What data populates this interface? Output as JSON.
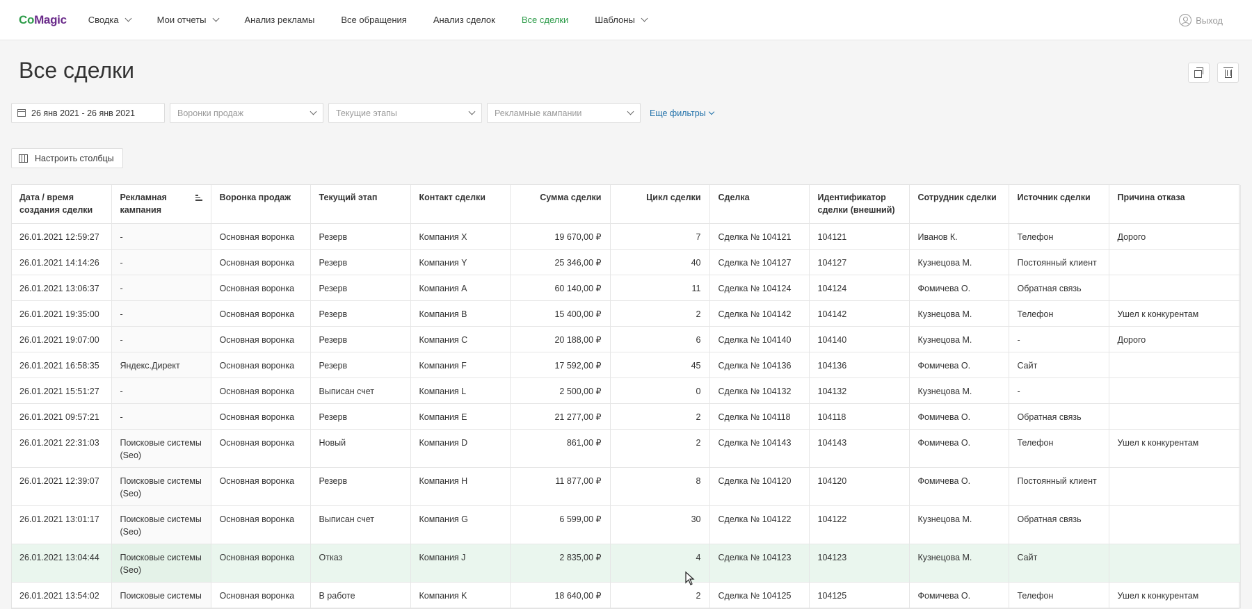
{
  "brand": {
    "logo_part1": "Co",
    "logo_part2": "Magic"
  },
  "nav": {
    "items": [
      {
        "label": "Сводка",
        "dropdown": true
      },
      {
        "label": "Мои отчеты",
        "dropdown": true
      },
      {
        "label": "Анализ рекламы"
      },
      {
        "label": "Все обращения"
      },
      {
        "label": "Анализ сделок"
      },
      {
        "label": "Все сделки",
        "active": true
      },
      {
        "label": "Шаблоны",
        "dropdown": true
      }
    ],
    "logout_label": "Выход"
  },
  "page": {
    "title": "Все сделки"
  },
  "filters": {
    "date_range": "26 янв 2021 - 26 янв 2021",
    "funnel_placeholder": "Воронки продаж",
    "stages_placeholder": "Текущие этапы",
    "campaigns_placeholder": "Рекламные кампании",
    "more_filters": "Еще фильтры"
  },
  "columns_button": "Настроить столбцы",
  "table": {
    "headers": [
      "Дата / время создания сделки",
      "Рекламная кампания",
      "Воронка продаж",
      "Текущий этап",
      "Контакт сделки",
      "Сумма сделки",
      "Цикл сделки",
      "Сделка",
      "Идентификатор сделки (внешний)",
      "Сотрудник сделки",
      "Источник сделки",
      "Причина отказа"
    ],
    "rows": [
      [
        "26.01.2021 12:59:27",
        "-",
        "Основная воронка",
        "Резерв",
        "Компания X",
        "19 670,00 ₽",
        "7",
        "Сделка № 104121",
        "104121",
        "Иванов К.",
        "Телефон",
        "Дорого"
      ],
      [
        "26.01.2021 14:14:26",
        "-",
        "Основная воронка",
        "Резерв",
        "Компания Y",
        "25 346,00 ₽",
        "40",
        "Сделка № 104127",
        "104127",
        "Кузнецова М.",
        "Постоянный клиент",
        ""
      ],
      [
        "26.01.2021 13:06:37",
        "-",
        "Основная воронка",
        "Резерв",
        "Компания A",
        "60 140,00 ₽",
        "11",
        "Сделка № 104124",
        "104124",
        "Фомичева О.",
        "Обратная связь",
        ""
      ],
      [
        "26.01.2021 19:35:00",
        "-",
        "Основная воронка",
        "Резерв",
        "Компания B",
        "15 400,00 ₽",
        "2",
        "Сделка № 104142",
        "104142",
        "Кузнецова М.",
        "Телефон",
        "Ушел к конкурентам"
      ],
      [
        "26.01.2021 19:07:00",
        "-",
        "Основная воронка",
        "Резерв",
        "Компания C",
        "20 188,00 ₽",
        "6",
        "Сделка № 104140",
        "104140",
        "Кузнецова М.",
        "-",
        "Дорого"
      ],
      [
        "26.01.2021 16:58:35",
        "Яндекс.Директ",
        "Основная воронка",
        "Резерв",
        "Компания F",
        "17 592,00 ₽",
        "45",
        "Сделка № 104136",
        "104136",
        "Фомичева О.",
        "Сайт",
        ""
      ],
      [
        "26.01.2021 15:51:27",
        "-",
        "Основная воронка",
        "Выписан счет",
        "Компания L",
        "2 500,00 ₽",
        "0",
        "Сделка № 104132",
        "104132",
        "Кузнецова М.",
        "-",
        ""
      ],
      [
        "26.01.2021 09:57:21",
        "-",
        "Основная воронка",
        "Резерв",
        "Компания E",
        "21 277,00 ₽",
        "2",
        "Сделка № 104118",
        "104118",
        "Фомичева О.",
        "Обратная связь",
        ""
      ],
      [
        "26.01.2021 22:31:03",
        "Поисковые системы (Seo)",
        "Основная воронка",
        "Новый",
        "Компания D",
        "861,00 ₽",
        "2",
        "Сделка № 104143",
        "104143",
        "Фомичева О.",
        "Телефон",
        "Ушел к конкурентам"
      ],
      [
        "26.01.2021 12:39:07",
        "Поисковые системы (Seo)",
        "Основная воронка",
        "Резерв",
        "Компания H",
        "11 877,00 ₽",
        "8",
        "Сделка № 104120",
        "104120",
        "Фомичева О.",
        "Постоянный клиент",
        ""
      ],
      [
        "26.01.2021 13:01:17",
        "Поисковые системы (Seo)",
        "Основная воронка",
        "Выписан счет",
        "Компания G",
        "6 599,00 ₽",
        "30",
        "Сделка № 104122",
        "104122",
        "Кузнецова М.",
        "Обратная связь",
        ""
      ],
      [
        "26.01.2021 13:04:44",
        "Поисковые системы (Seo)",
        "Основная воронка",
        "Отказ",
        "Компания J",
        "2 835,00 ₽",
        "4",
        "Сделка № 104123",
        "104123",
        "Кузнецова М.",
        "Сайт",
        ""
      ],
      [
        "26.01.2021 13:54:02",
        "Поисковые системы",
        "Основная воронка",
        "В работе",
        "Компания K",
        "18 640,00 ₽",
        "2",
        "Сделка № 104125",
        "104125",
        "Фомичева О.",
        "Телефон",
        "Ушел к конкурентам"
      ]
    ],
    "highlighted_row": 11
  },
  "colors": {
    "accent_green": "#2e9c4a",
    "link_blue": "#1e6fa8",
    "row_highlight": "#eaf6ee"
  }
}
